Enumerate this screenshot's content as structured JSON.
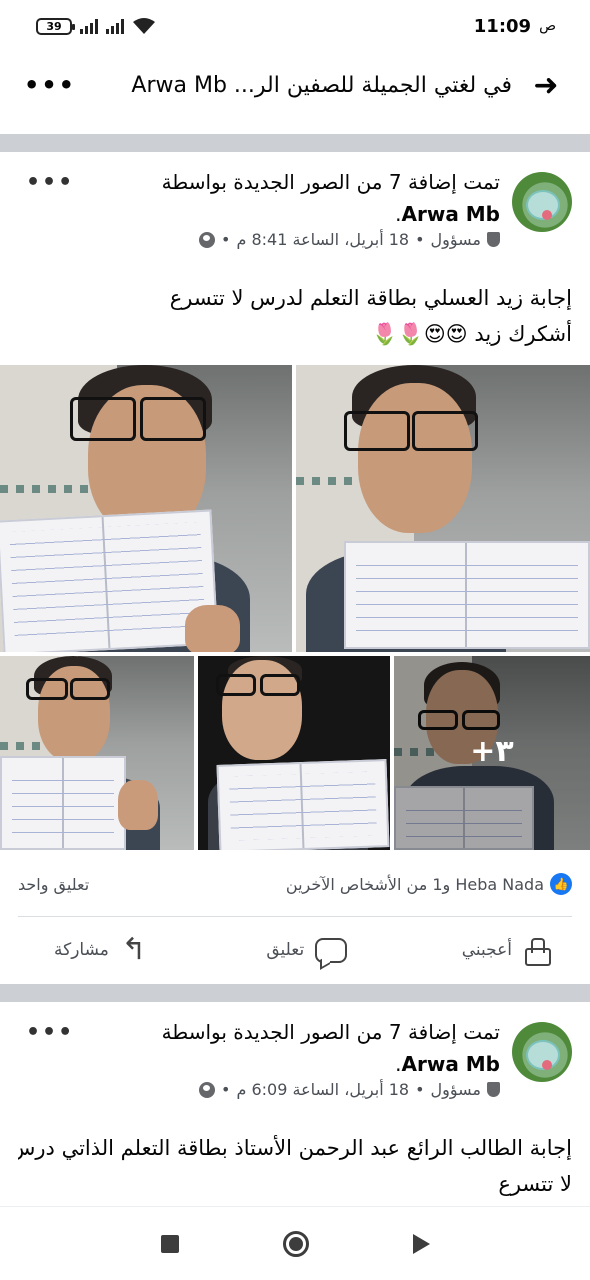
{
  "status_bar": {
    "battery": "39",
    "time": "11:09",
    "ampm": "ص"
  },
  "header": {
    "title": "في لغتي الجميلة للصفين الر... Arwa Mb",
    "back_icon": "arrow-right-icon",
    "more_icon": "more-dots-icon"
  },
  "posts": [
    {
      "author": "Arwa Mb",
      "title_prefix": "تمت إضافة 7 من الصور الجديدة بواسطة ",
      "title_suffix": ".",
      "role": "مسؤول",
      "date": "18 أبريل، الساعة 8:41 م",
      "text_lines": [
        "إجابة زيد العسلي بطاقة التعلم لدرس لا تتسرع",
        "أشكرك زيد 😍😍🌷🌷"
      ],
      "photos_more": "+٣",
      "reactions": {
        "names": "Heba Nada و1 من الأشخاص الآخرين",
        "comments": "تعليق واحد"
      },
      "actions": {
        "like": "أعجبني",
        "comment": "تعليق",
        "share": "مشاركة"
      }
    },
    {
      "author": "Arwa Mb",
      "title_prefix": "تمت إضافة 7 من الصور الجديدة بواسطة ",
      "title_suffix": ".",
      "role": "مسؤول",
      "date": "18 أبريل، الساعة 6:09 م",
      "text_lines": [
        "إجابة الطالب الرائع عبد الرحمن الأستاذ بطاقة التعلم الذاتي درس",
        "لا تتسرع"
      ]
    }
  ],
  "colors": {
    "facebook_blue": "#1877f2",
    "separator": "#ccd0d5",
    "meta_text": "#4b4f56"
  }
}
